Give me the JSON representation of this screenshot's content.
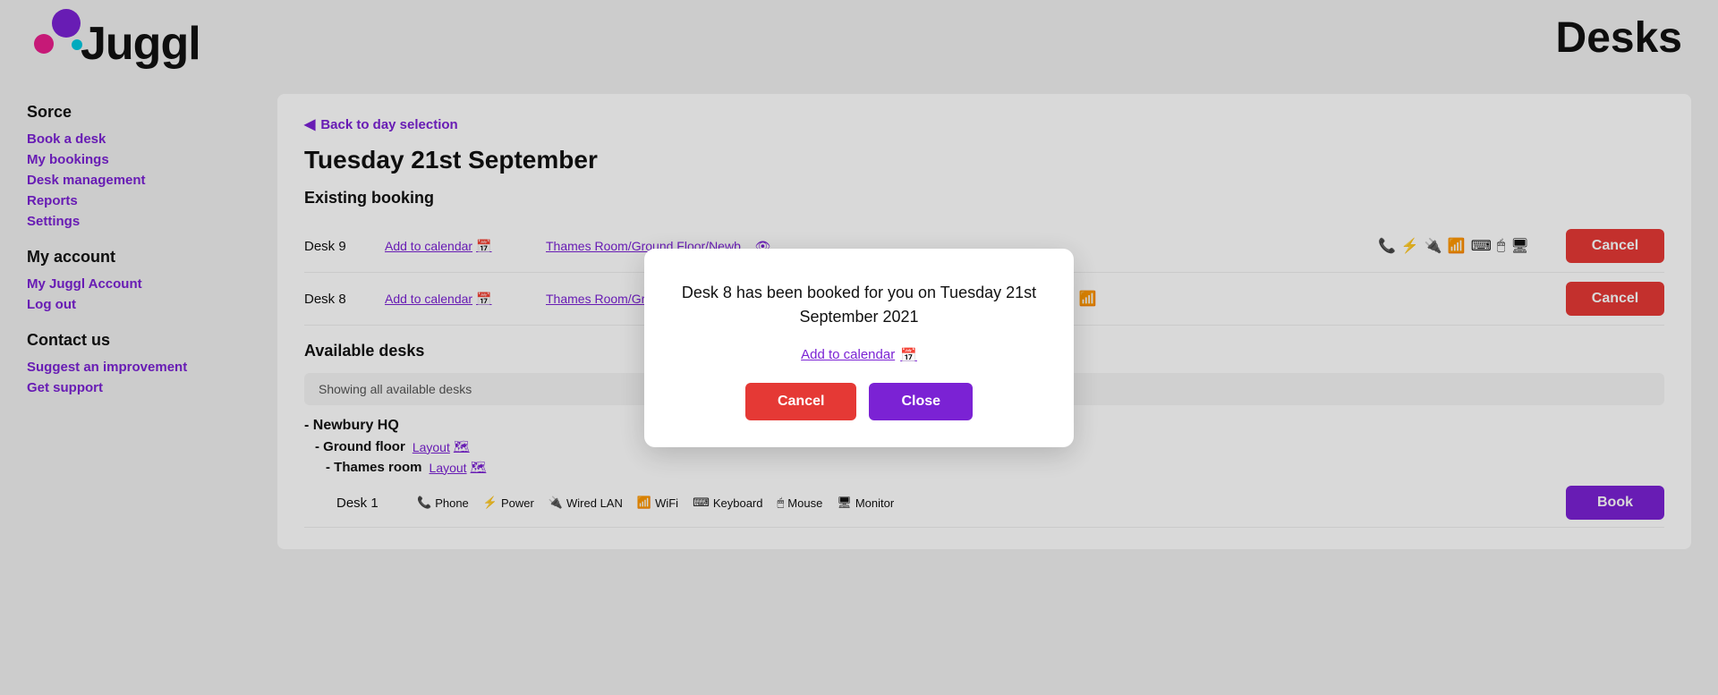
{
  "header": {
    "logo_text": "Juggl",
    "page_title": "Desks"
  },
  "sidebar": {
    "sections": [
      {
        "title": "Sorce",
        "links": [
          {
            "label": "Book a desk",
            "active": true
          },
          {
            "label": "My bookings",
            "active": false
          },
          {
            "label": "Desk management",
            "active": false
          },
          {
            "label": "Reports",
            "active": false
          },
          {
            "label": "Settings",
            "active": false
          }
        ]
      },
      {
        "title": "My account",
        "links": [
          {
            "label": "My Juggl Account",
            "active": false
          },
          {
            "label": "Log out",
            "active": false
          }
        ]
      },
      {
        "title": "Contact us",
        "links": [
          {
            "label": "Suggest an improvement",
            "active": false
          },
          {
            "label": "Get support",
            "active": false
          }
        ]
      }
    ]
  },
  "main": {
    "back_link": "Back to day selection",
    "date_heading": "Tuesday 21st September",
    "existing_booking_heading": "Existing booking",
    "desks": [
      {
        "name": "Desk 9",
        "calendar_link": "Add to calendar",
        "location_link": "Thames Room/Ground Floor/Newb...",
        "amenities": [
          "phone",
          "power",
          "wired-lan",
          "wifi",
          "keyboard",
          "mouse",
          "monitor"
        ],
        "has_cancel": true
      },
      {
        "name": "Desk 8",
        "calendar_link": "Add to calendar",
        "location_link": "Thames Room/Ground Floor/Newb...",
        "amenities": [
          "power",
          "wifi"
        ],
        "has_cancel": true
      }
    ],
    "available_desks_heading": "Available desks",
    "filter_text": "Showing all available desks",
    "locations": [
      {
        "name": "- Newbury HQ",
        "floors": [
          {
            "name": "- Ground floor",
            "layout_label": "Layout",
            "rooms": [
              {
                "name": "- Thames room",
                "layout_label": "Layout",
                "desks": [
                  {
                    "name": "Desk 1",
                    "amenities": [
                      {
                        "icon": "phone-icon",
                        "label": "Phone"
                      },
                      {
                        "icon": "power-icon",
                        "label": "Power"
                      },
                      {
                        "icon": "wired-lan-icon",
                        "label": "Wired LAN"
                      },
                      {
                        "icon": "wifi-icon",
                        "label": "WiFi"
                      },
                      {
                        "icon": "keyboard-icon",
                        "label": "Keyboard"
                      },
                      {
                        "icon": "mouse-icon",
                        "label": "Mouse"
                      },
                      {
                        "icon": "monitor-icon",
                        "label": "Monitor"
                      }
                    ],
                    "book_label": "Book"
                  }
                ]
              }
            ]
          }
        ]
      }
    ]
  },
  "modal": {
    "message": "Desk 8 has been booked for you on Tuesday 21st September 2021",
    "calendar_link": "Add to calendar",
    "cancel_label": "Cancel",
    "close_label": "Close"
  },
  "icons": {
    "phone": "📞",
    "power": "⚡",
    "wired_lan": "🔌",
    "wifi": "📶",
    "keyboard": "⌨",
    "mouse": "🖱",
    "monitor": "🖥",
    "calendar": "📅",
    "eye": "👁",
    "map": "🗺"
  }
}
